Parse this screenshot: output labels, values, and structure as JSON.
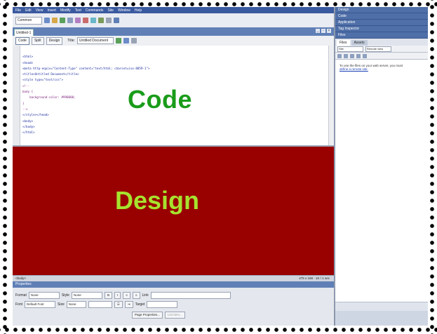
{
  "menubar": {
    "items": [
      "File",
      "Edit",
      "View",
      "Insert",
      "Modify",
      "Text",
      "Commands",
      "Site",
      "Window",
      "Help"
    ]
  },
  "toolbar": {
    "insert_category": "Common"
  },
  "document": {
    "tab_label": "Untitled-1",
    "views": [
      "Code",
      "Split",
      "Design"
    ],
    "title_label": "Title:",
    "title_value": "Untitled Document"
  },
  "code": {
    "lines": [
      "<html>",
      "<head>",
      "<meta http-equiv=\"Content-Type\" content=\"text/html; charset=iso-8859-1\">",
      "<title>Untitled Document</title>",
      "<style type=\"text/css\">",
      "<!--",
      "body {",
      "    background-color: #990000;",
      "}",
      "-->",
      "</style></head>",
      "",
      "<body>",
      "</body>",
      "</html>"
    ],
    "overlay_label": "Code"
  },
  "design": {
    "overlay_label": "Design",
    "background": "#990000"
  },
  "statusbar": {
    "tag": "<body>",
    "info": "475 x 168 · 1K / 1 sec"
  },
  "properties": {
    "title": "Properties",
    "format_label": "Format",
    "format_value": "None",
    "style_label": "Style",
    "style_value": "None",
    "font_label": "Font",
    "font_value": "Default Font",
    "size_label": "Size",
    "size_value": "None",
    "link_label": "Link",
    "target_label": "Target",
    "page_props_button": "Page Properties...",
    "list_item_button": "List Item..."
  },
  "rpanel": {
    "groups": [
      "Design",
      "Code",
      "Application",
      "Tag Inspector",
      "Files"
    ],
    "files_tabs": [
      "Files",
      "Assets"
    ],
    "site_select": "Site",
    "view_select": "Remote view",
    "body_text": "To use the files on your web server, you must",
    "body_link": "define a remote site."
  },
  "colors": {
    "code_word": "#1a9c1a",
    "design_word": "#a6e22e",
    "design_bg": "#990000",
    "chrome_blue": "#5f7fb6"
  }
}
